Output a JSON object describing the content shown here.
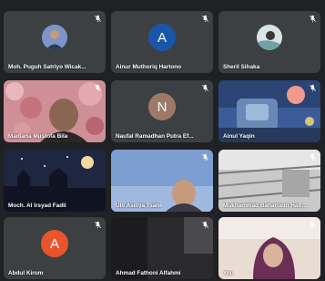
{
  "participants": [
    {
      "name": "Moh. Puguh Satriyo Wicak...",
      "type": "photo"
    },
    {
      "name": "Ainur Muthoriq Hartono",
      "type": "initial",
      "initial": "A",
      "color": "#1a56a8"
    },
    {
      "name": "Sheril Sihaka",
      "type": "photo"
    },
    {
      "name": "Madiana Mustofa Bila",
      "type": "video"
    },
    {
      "name": "Naufal Ramadhan Putra Ef...",
      "type": "initial",
      "initial": "N",
      "color": "#9d7a68"
    },
    {
      "name": "Ainul Yaqin",
      "type": "video"
    },
    {
      "name": "Moch. Al Irsyad Fadli",
      "type": "video"
    },
    {
      "name": "Ulil Asiliya Tsani",
      "type": "video"
    },
    {
      "name": "Mukhammad Baharudin Hafianto",
      "type": "video"
    },
    {
      "name": "Abdul Kirom",
      "type": "initial",
      "initial": "A",
      "color": "#e8542c"
    },
    {
      "name": "Ahmad Fathoni Alfahmi",
      "type": "video"
    },
    {
      "name": "You",
      "type": "video"
    }
  ],
  "icons": {
    "muted": "mic-off-icon"
  }
}
